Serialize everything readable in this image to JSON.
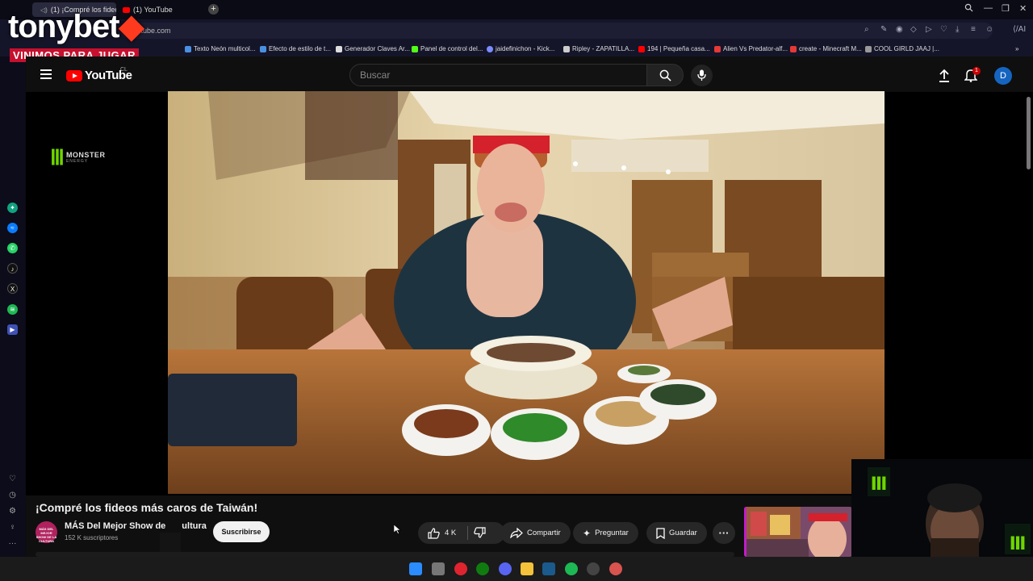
{
  "overlay": {
    "brand": "tonybet",
    "tagline": "VINIMOS PARA JUGAR",
    "sponsor_word": "MONSTER",
    "sponsor_sub": "ENERGY"
  },
  "browser": {
    "tabs": [
      {
        "label": "(1) ¡Compré los fideos"
      },
      {
        "label": "(1) YouTube"
      }
    ],
    "address": "youtube.com",
    "bookmarks": [
      {
        "label": "Texto Neón multicol...",
        "color": "#4a90e2"
      },
      {
        "label": "Efecto de estilo de t...",
        "color": "#4a90e2"
      },
      {
        "label": "Generador Claves Ar...",
        "color": "#dddddd"
      },
      {
        "label": "Panel de control del...",
        "color": "#53fc18"
      },
      {
        "label": "jaidefinichon - Kick...",
        "color": "#7b8cff"
      },
      {
        "label": "Ripley - ZAPATILLA...",
        "color": "#cccccc"
      },
      {
        "label": "194 | Pequeña casa...",
        "color": "#ff0000"
      },
      {
        "label": "Alien Vs Predator-alf...",
        "color": "#e53935"
      },
      {
        "label": "create - Minecraft M...",
        "color": "#e53935"
      },
      {
        "label": "COOL GIRLD JAAJ |...",
        "color": "#999999"
      }
    ]
  },
  "youtube": {
    "logo_text": "YouTube",
    "region": "CL",
    "search_placeholder": "Buscar",
    "notifications": "1",
    "avatar_initial": "D"
  },
  "video": {
    "title": "¡Compré los fideos más caros de Taiwán!",
    "channel_name": "MÁS Del Mejor Show de",
    "channel_name_tail": "ultura",
    "channel_avatar_text": "MÁS DEL MEJOR SHOW DE LA CULTURA",
    "subscribers": "152 K suscriptores",
    "subscribe_label": "Suscribirse",
    "likes": "4 K",
    "share_label": "Compartir",
    "ask_label": "Preguntar",
    "save_label": "Guardar"
  },
  "colors": {
    "accent_red": "#ff0000",
    "subscribe_bg": "#f1f1f1",
    "monster_green": "#6fd600",
    "avatar_blue": "#1565c0"
  }
}
